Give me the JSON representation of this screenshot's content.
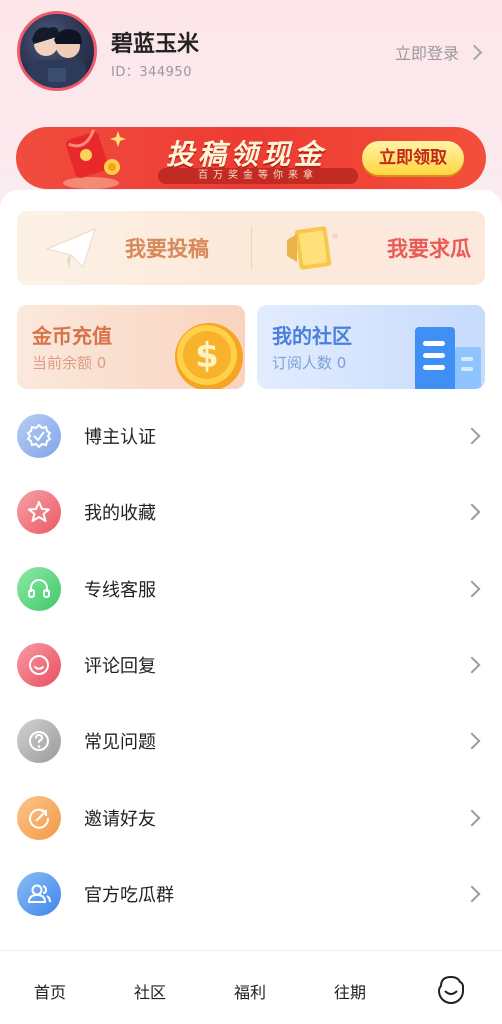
{
  "profile": {
    "username": "碧蓝玉米",
    "user_id": "ID：344950",
    "login_label": "立即登录"
  },
  "banner": {
    "title": "投稿领现金",
    "subtitle": "百万奖金等你来拿",
    "claim_label": "立即领取"
  },
  "actions": {
    "submit_label": "我要投稿",
    "request_label": "我要求瓜"
  },
  "stats": {
    "coins_title": "金币充值",
    "coins_sub": "当前余额 0",
    "community_title": "我的社区",
    "community_sub": "订阅人数 0"
  },
  "menu": [
    {
      "label": "博主认证",
      "icon": "verified-badge-icon",
      "color": "#8fb3ef"
    },
    {
      "label": "我的收藏",
      "icon": "star-icon",
      "color": "#ef6f79"
    },
    {
      "label": "专线客服",
      "icon": "headset-icon",
      "color": "#52d27a"
    },
    {
      "label": "评论回复",
      "icon": "smile-comment-icon",
      "color": "#ef5f6e"
    },
    {
      "label": "常见问题",
      "icon": "question-icon",
      "color": "#a9a9a9"
    },
    {
      "label": "邀请好友",
      "icon": "invite-icon",
      "color": "#f5a65a"
    },
    {
      "label": "官方吃瓜群",
      "icon": "group-icon",
      "color": "#4f93ec"
    }
  ],
  "nav": {
    "home": "首页",
    "community": "社区",
    "welfare": "福利",
    "archive": "往期"
  }
}
